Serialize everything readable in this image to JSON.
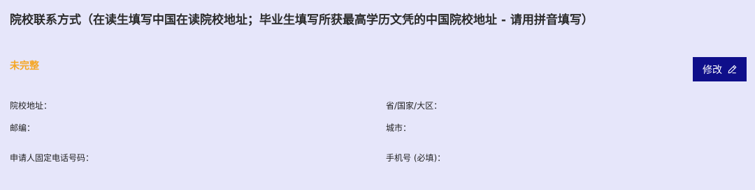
{
  "section": {
    "title": "院校联系方式（在读生填写中国在读院校地址；毕业生填写所获最高学历文凭的中国院校地址 - 请用拼音填写）",
    "status": "未完整",
    "edit_button_label": "修改",
    "edit_icon": "pencil-icon",
    "status_color": "#f5a623",
    "button_color": "#0f0f8a",
    "background_color": "#e6e6fa"
  },
  "fields": {
    "school_address": {
      "label": "院校地址：",
      "value": ""
    },
    "province": {
      "label": "省/国家/大区：",
      "value": ""
    },
    "postcode": {
      "label": "邮编：",
      "value": ""
    },
    "city": {
      "label": "城市：",
      "value": ""
    },
    "landline": {
      "label": "申请人固定电话号码：",
      "value": ""
    },
    "mobile": {
      "label": "手机号 (必填)：",
      "value": ""
    }
  }
}
